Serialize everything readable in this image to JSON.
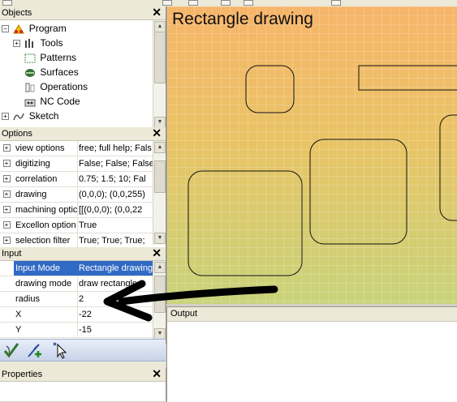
{
  "objects_panel": {
    "title": "Objects",
    "close": "✕",
    "tree": [
      {
        "label": "Program",
        "icon": "program-icon"
      },
      {
        "label": "Tools",
        "icon": "tools-icon"
      },
      {
        "label": "Patterns",
        "icon": "patterns-icon"
      },
      {
        "label": "Surfaces",
        "icon": "surfaces-icon"
      },
      {
        "label": "Operations",
        "icon": "operations-icon"
      },
      {
        "label": "NC Code",
        "icon": "nc-code-icon"
      },
      {
        "label": "Sketch",
        "icon": "sketch-icon"
      }
    ]
  },
  "options_panel": {
    "title": "Options",
    "close": "✕",
    "rows": [
      {
        "name": "view options",
        "value": "free; full help; Fals"
      },
      {
        "name": "digitizing",
        "value": "False; False; False"
      },
      {
        "name": "correlation",
        "value": "0.75; 1.5; 10; Fal"
      },
      {
        "name": "drawing",
        "value": "(0,0,0); (0,0,255)"
      },
      {
        "name": "machining optic",
        "value": "[[(0,0,0); (0,0,22"
      },
      {
        "name": "Excellon option",
        "value": "True"
      },
      {
        "name": "selection filter",
        "value": "True; True; True;"
      }
    ]
  },
  "input_panel": {
    "title": "Input",
    "close": "✕",
    "rows": [
      {
        "name": "Input Mode",
        "value": "Rectangle drawing"
      },
      {
        "name": "drawing mode",
        "value": "draw rectangles"
      },
      {
        "name": "radius",
        "value": "2"
      },
      {
        "name": "X",
        "value": "-22"
      },
      {
        "name": "Y",
        "value": "-15"
      }
    ]
  },
  "toolbar": {
    "buttons": [
      {
        "name": "apply-icon"
      },
      {
        "name": "add-point-icon"
      },
      {
        "name": "select-cursor-icon"
      }
    ]
  },
  "properties_panel": {
    "title": "Properties",
    "close": "✕"
  },
  "canvas": {
    "title": "Rectangle drawing"
  },
  "output_panel": {
    "title": "Output"
  },
  "colors": {
    "selection": "#316ac5",
    "canvas_top": "#f7b56a",
    "canvas_bottom": "#c8d37a"
  }
}
